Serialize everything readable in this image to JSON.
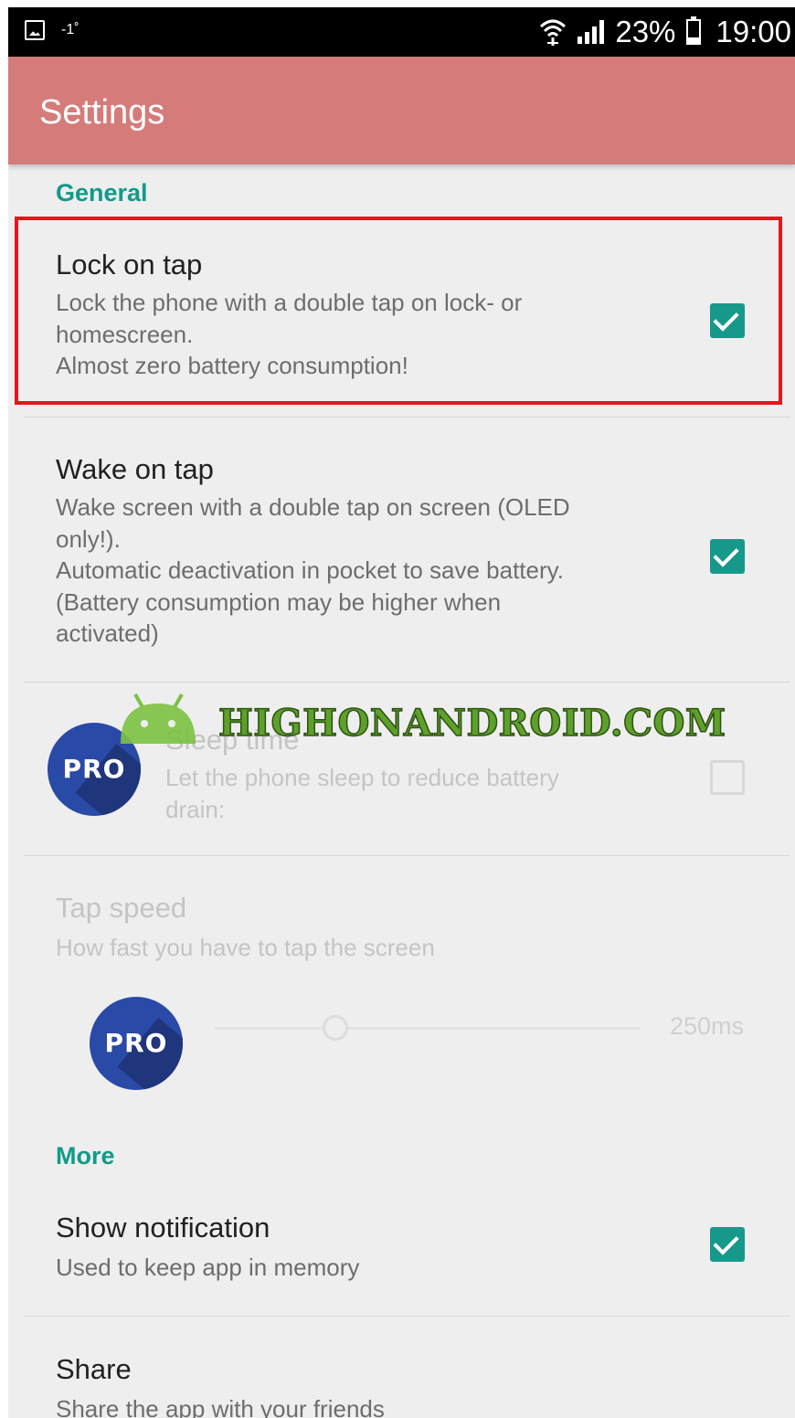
{
  "status_bar": {
    "temperature": "-1˚",
    "battery": "23%",
    "battery_level": 0.23,
    "time": "19:00"
  },
  "app_bar": {
    "title": "Settings"
  },
  "sections": {
    "general": "General",
    "more": "More"
  },
  "prefs": {
    "lock_on_tap": {
      "title": "Lock on tap",
      "summary": "Lock the phone with a double tap on lock- or\nhomescreen.\nAlmost zero battery consumption!",
      "checked": true
    },
    "wake_on_tap": {
      "title": "Wake on tap",
      "summary": "Wake screen with a double tap on screen (OLED\nonly!).\nAutomatic deactivation in pocket to save battery.\n(Battery consumption may be higher when\nactivated)",
      "checked": true
    },
    "sleep_time": {
      "title": "Sleep time",
      "summary": "Let the phone sleep to reduce battery\ndrain:",
      "checked": false
    },
    "tap_speed": {
      "title": "Tap speed",
      "summary": "How fast you have to tap the screen",
      "value": "250ms"
    },
    "show_notification": {
      "title": "Show notification",
      "summary": "Used to keep app in memory",
      "checked": true
    },
    "share": {
      "title": "Share",
      "summary": "Share the app with your friends"
    }
  },
  "pro_badge_label": "PRO",
  "watermark": "HIGHONANDROID.COM",
  "colors": {
    "app_bar": "#d57b79",
    "accent": "#16998a",
    "highlight": "#e8141a",
    "pro_badge": "#2a4aa8"
  }
}
